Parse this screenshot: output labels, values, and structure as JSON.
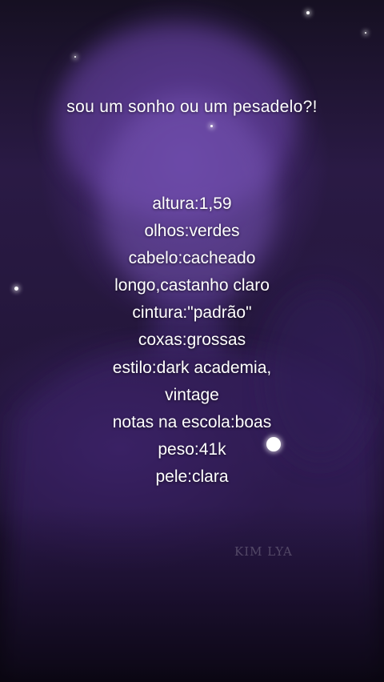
{
  "overlay": {
    "headline": "sou um sonho ou um pesadelo?!",
    "lines": [
      "altura:1,59",
      "olhos:verdes",
      "cabelo:cacheado",
      "longo,castanho claro",
      "cintura:\"padrão\"",
      "coxas:grossas",
      "estilo:dark academia,",
      "vintage",
      "notas na escola:boas",
      "peso:41k",
      "pele:clara"
    ]
  },
  "watermark": "KIM LYA",
  "colors": {
    "tint": "#5a2fa0",
    "text": "#ffffff",
    "background": "#140c22"
  }
}
